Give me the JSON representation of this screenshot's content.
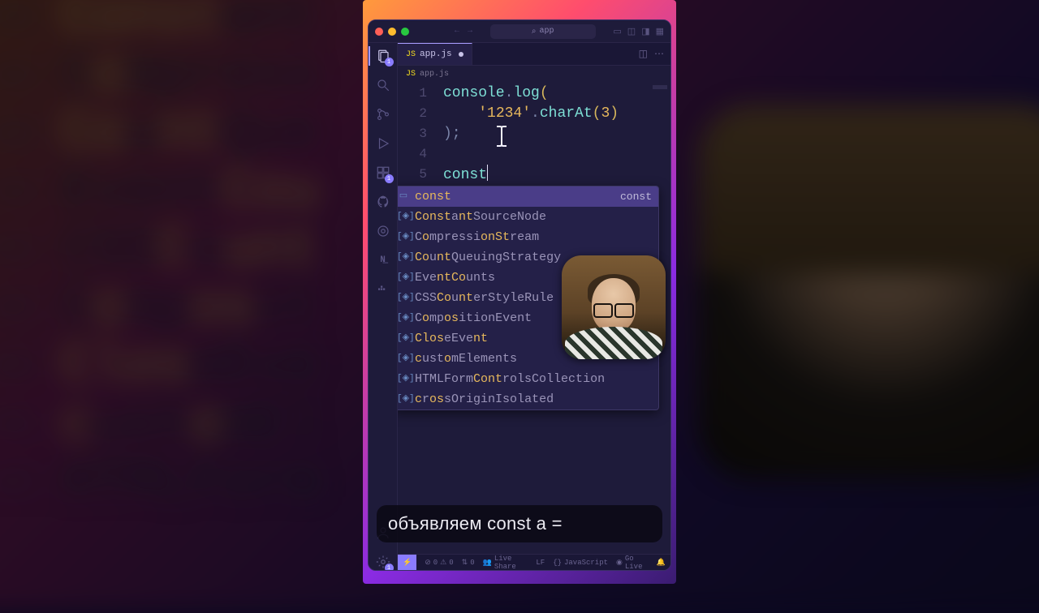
{
  "titlebar": {
    "search_placeholder": "app"
  },
  "tabs": [
    {
      "label": "app.js",
      "dirty": true
    }
  ],
  "breadcrumb": {
    "file": "app.js"
  },
  "code": {
    "lines": [
      "1",
      "2",
      "3",
      "4",
      "5"
    ],
    "l1_obj": "console",
    "l1_dot": ".",
    "l1_meth": "log",
    "l1_open": "(",
    "l2_indent": "    ",
    "l2_str": "'1234'",
    "l2_dot": ".",
    "l2_meth": "charAt",
    "l2_open": "(",
    "l2_arg": "3",
    "l2_close": ")",
    "l3_close": ");",
    "l5_kw": "const"
  },
  "suggest": {
    "hint": "const",
    "items": [
      {
        "pre": "",
        "m1": "const",
        "mid": "",
        "m2": "",
        "post": ""
      },
      {
        "pre": "",
        "m1": "Const",
        "mid": "a",
        "m2": "nt",
        "post": "SourceNode"
      },
      {
        "pre": "C",
        "m1": "o",
        "mid": "mpressi",
        "m2": "onSt",
        "post": "ream"
      },
      {
        "pre": "",
        "m1": "Co",
        "mid": "u",
        "m2": "nt",
        "post": "QueuingStrategy"
      },
      {
        "pre": "Eve",
        "m1": "nt",
        "mid": "",
        "m2": "Co",
        "post": "unts"
      },
      {
        "pre": "CSS",
        "m1": "Co",
        "mid": "u",
        "m2": "nt",
        "post": "erStyleRule"
      },
      {
        "pre": "C",
        "m1": "o",
        "mid": "mp",
        "m2": "os",
        "post": "itionEvent"
      },
      {
        "pre": "",
        "m1": "Clos",
        "mid": "eEve",
        "m2": "nt",
        "post": ""
      },
      {
        "pre": "",
        "m1": "c",
        "mid": "ust",
        "m2": "o",
        "post": "mElements"
      },
      {
        "pre": "HTMLForm",
        "m1": "Co",
        "mid": "",
        "m2": "nt",
        "post": "rolsCollection"
      },
      {
        "pre": "",
        "m1": "c",
        "mid": "r",
        "m2": "os",
        "post": "sOriginIsolated"
      }
    ]
  },
  "bg_rows": [
    [
      [
        "Const",
        1
      ],
      [
        "ant",
        0
      ]
    ],
    [
      [
        "C",
        0
      ],
      [
        "o",
        1
      ],
      [
        "mpress",
        0
      ]
    ],
    [
      [
        "Co",
        1
      ],
      [
        "u",
        0
      ],
      [
        "nt",
        1
      ],
      [
        "Que",
        0
      ]
    ],
    [
      [
        "Event",
        0
      ],
      [
        "Cou",
        1
      ]
    ],
    [
      [
        "CSS",
        0
      ],
      [
        "C",
        1
      ],
      [
        "o",
        0
      ],
      [
        "unt",
        1
      ]
    ],
    [
      [
        "C",
        0
      ],
      [
        "o",
        1
      ],
      [
        "mp",
        0
      ],
      [
        "os",
        1
      ],
      [
        "it",
        0
      ]
    ],
    [
      [
        "Clos",
        1
      ],
      [
        "eEve",
        0
      ]
    ],
    [
      [
        "c",
        1
      ],
      [
        "ust",
        0
      ],
      [
        "o",
        1
      ],
      [
        "mEl",
        0
      ]
    ],
    [
      [
        "HTMLForm",
        0
      ]
    ]
  ],
  "caption": "объявляем const a =",
  "status": {
    "errors": "0",
    "warnings": "0",
    "ports": "0",
    "liveshare": "Live Share",
    "lf": "LF",
    "lang": "JavaScript",
    "golive": "Go Live"
  },
  "activity_badge_top": "1",
  "activity_badge_ext": "1"
}
